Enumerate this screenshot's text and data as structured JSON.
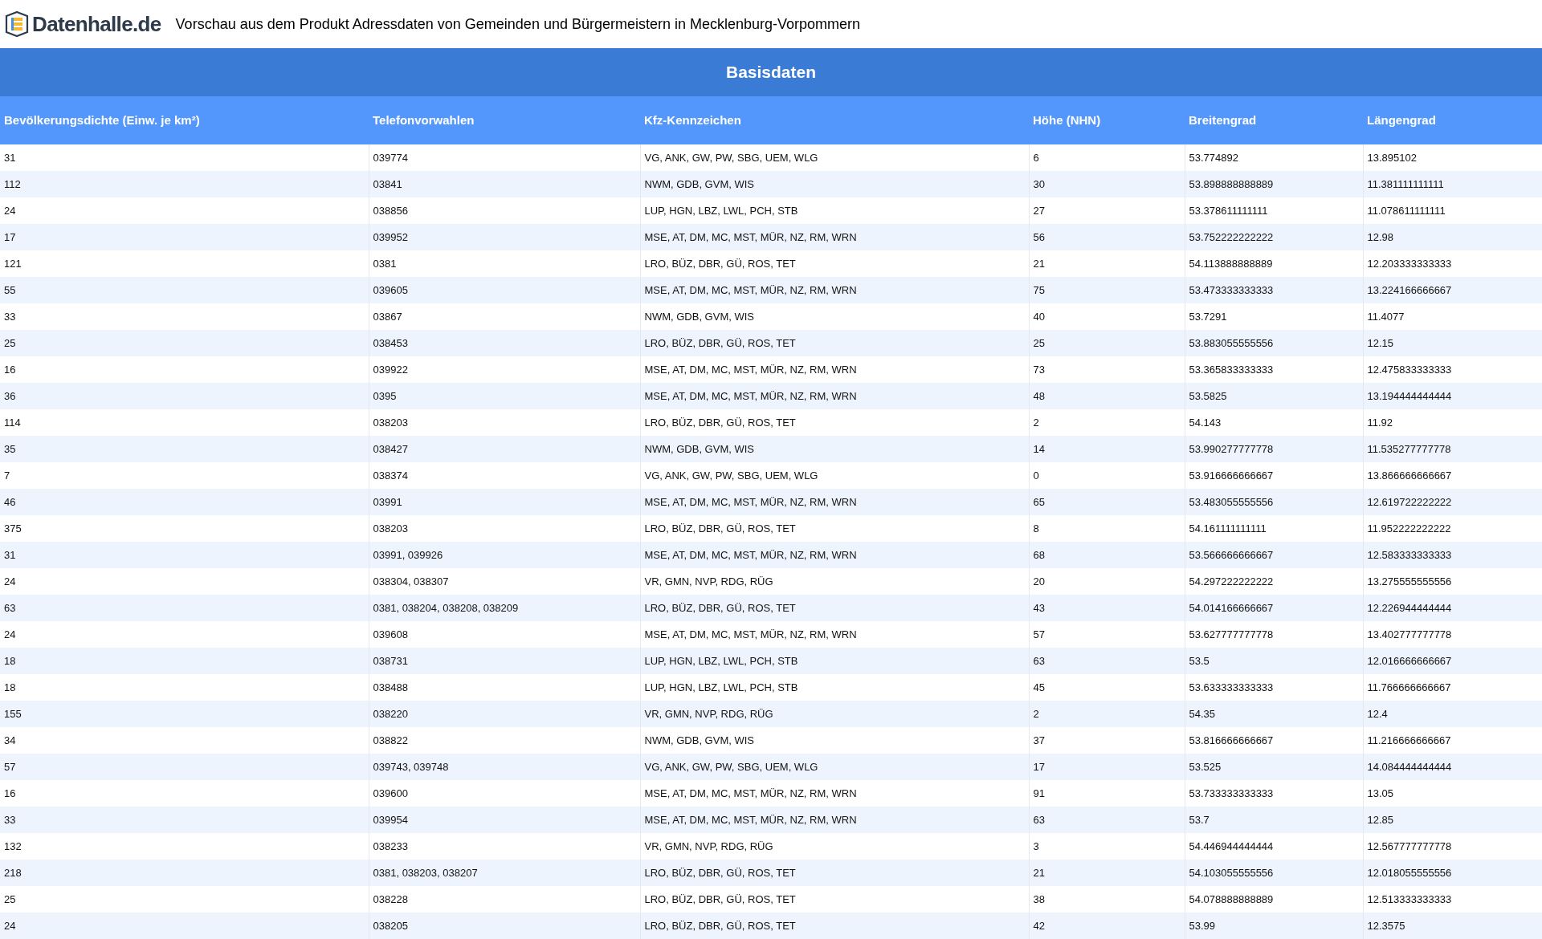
{
  "header": {
    "logo_text": "Datenhalle.de",
    "title": "Vorschau aus dem Produkt Adressdaten von Gemeinden und Bürgermeistern in Mecklenburg-Vorpommern"
  },
  "table": {
    "section_title": "Basisdaten",
    "columns": [
      "Bevölkerungsdichte (Einw. je km²)",
      "Telefonvorwahlen",
      "Kfz-Kennzeichen",
      "Höhe (NHN)",
      "Breitengrad",
      "Längengrad"
    ],
    "rows": [
      [
        "31",
        "039774",
        "VG, ANK, GW, PW, SBG, UEM, WLG",
        "6",
        "53.774892",
        "13.895102"
      ],
      [
        "112",
        "03841",
        "NWM, GDB, GVM, WIS",
        "30",
        "53.898888888889",
        "11.381111111111"
      ],
      [
        "24",
        "038856",
        "LUP, HGN, LBZ, LWL, PCH, STB",
        "27",
        "53.378611111111",
        "11.078611111111"
      ],
      [
        "17",
        "039952",
        "MSE, AT, DM, MC, MST, MÜR, NZ, RM, WRN",
        "56",
        "53.752222222222",
        "12.98"
      ],
      [
        "121",
        "0381",
        "LRO, BÜZ, DBR, GÜ, ROS, TET",
        "21",
        "54.113888888889",
        "12.203333333333"
      ],
      [
        "55",
        "039605",
        "MSE, AT, DM, MC, MST, MÜR, NZ, RM, WRN",
        "75",
        "53.473333333333",
        "13.224166666667"
      ],
      [
        "33",
        "03867",
        "NWM, GDB, GVM, WIS",
        "40",
        "53.7291",
        "11.4077"
      ],
      [
        "25",
        "038453",
        "LRO, BÜZ, DBR, GÜ, ROS, TET",
        "25",
        "53.883055555556",
        "12.15"
      ],
      [
        "16",
        "039922",
        "MSE, AT, DM, MC, MST, MÜR, NZ, RM, WRN",
        "73",
        "53.365833333333",
        "12.475833333333"
      ],
      [
        "36",
        "0395",
        "MSE, AT, DM, MC, MST, MÜR, NZ, RM, WRN",
        "48",
        "53.5825",
        "13.194444444444"
      ],
      [
        "114",
        "038203",
        "LRO, BÜZ, DBR, GÜ, ROS, TET",
        "2",
        "54.143",
        "11.92"
      ],
      [
        "35",
        "038427",
        "NWM, GDB, GVM, WIS",
        "14",
        "53.990277777778",
        "11.535277777778"
      ],
      [
        "7",
        "038374",
        "VG, ANK, GW, PW, SBG, UEM, WLG",
        "0",
        "53.916666666667",
        "13.866666666667"
      ],
      [
        "46",
        "03991",
        "MSE, AT, DM, MC, MST, MÜR, NZ, RM, WRN",
        "65",
        "53.483055555556",
        "12.619722222222"
      ],
      [
        "375",
        "038203",
        "LRO, BÜZ, DBR, GÜ, ROS, TET",
        "8",
        "54.161111111111",
        "11.952222222222"
      ],
      [
        "31",
        "03991, 039926",
        "MSE, AT, DM, MC, MST, MÜR, NZ, RM, WRN",
        "68",
        "53.566666666667",
        "12.583333333333"
      ],
      [
        "24",
        "038304, 038307",
        "VR, GMN, NVP, RDG, RÜG",
        "20",
        "54.297222222222",
        "13.275555555556"
      ],
      [
        "63",
        "0381, 038204, 038208, 038209",
        "LRO, BÜZ, DBR, GÜ, ROS, TET",
        "43",
        "54.014166666667",
        "12.226944444444"
      ],
      [
        "24",
        "039608",
        "MSE, AT, DM, MC, MST, MÜR, NZ, RM, WRN",
        "57",
        "53.627777777778",
        "13.402777777778"
      ],
      [
        "18",
        "038731",
        "LUP, HGN, LBZ, LWL, PCH, STB",
        "63",
        "53.5",
        "12.016666666667"
      ],
      [
        "18",
        "038488",
        "LUP, HGN, LBZ, LWL, PCH, STB",
        "45",
        "53.633333333333",
        "11.766666666667"
      ],
      [
        "155",
        "038220",
        "VR, GMN, NVP, RDG, RÜG",
        "2",
        "54.35",
        "12.4"
      ],
      [
        "34",
        "038822",
        "NWM, GDB, GVM, WIS",
        "37",
        "53.816666666667",
        "11.216666666667"
      ],
      [
        "57",
        "039743, 039748",
        "VG, ANK, GW, PW, SBG, UEM, WLG",
        "17",
        "53.525",
        "14.084444444444"
      ],
      [
        "16",
        "039600",
        "MSE, AT, DM, MC, MST, MÜR, NZ, RM, WRN",
        "91",
        "53.733333333333",
        "13.05"
      ],
      [
        "33",
        "039954",
        "MSE, AT, DM, MC, MST, MÜR, NZ, RM, WRN",
        "63",
        "53.7",
        "12.85"
      ],
      [
        "132",
        "038233",
        "VR, GMN, NVP, RDG, RÜG",
        "3",
        "54.446944444444",
        "12.567777777778"
      ],
      [
        "218",
        "0381, 038203, 038207",
        "LRO, BÜZ, DBR, GÜ, ROS, TET",
        "21",
        "54.103055555556",
        "12.018055555556"
      ],
      [
        "25",
        "038228",
        "LRO, BÜZ, DBR, GÜ, ROS, TET",
        "38",
        "54.078888888889",
        "12.513333333333"
      ],
      [
        "24",
        "038205",
        "LRO, BÜZ, DBR, GÜ, ROS, TET",
        "42",
        "53.99",
        "12.3575"
      ]
    ]
  }
}
